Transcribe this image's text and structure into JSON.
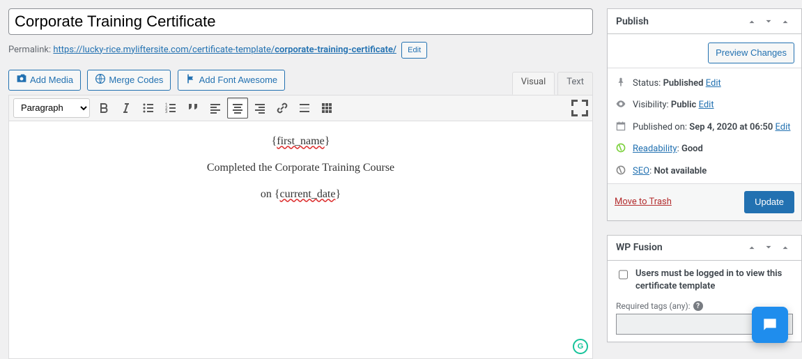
{
  "title_value": "Corporate Training Certificate",
  "permalink": {
    "label": "Permalink:",
    "base": "https://lucky-rice.myliftersite.com/certificate-template/",
    "slug": "corporate-training-certificate/",
    "edit": "Edit"
  },
  "media_buttons": {
    "add_media": "Add Media",
    "merge_codes": "Merge Codes",
    "font_awesome": "Add Font Awesome"
  },
  "editor_tabs": {
    "visual": "Visual",
    "text": "Text"
  },
  "toolbar": {
    "format_select": "Paragraph"
  },
  "content": {
    "line1_a": "{",
    "line1_b": "first_name",
    "line1_c": "}",
    "line2": "Completed the Corporate Training Course",
    "line3_a": "on {",
    "line3_b": "current_date",
    "line3_c": "}"
  },
  "publish": {
    "title": "Publish",
    "preview": "Preview Changes",
    "status_label": "Status:",
    "status_value": "Published",
    "visibility_label": "Visibility:",
    "visibility_value": "Public",
    "published_label": "Published on:",
    "published_value": "Sep 4, 2020 at 06:50",
    "readability_label": "Readability",
    "readability_value": "Good",
    "seo_label": "SEO",
    "seo_value": "Not available",
    "edit": "Edit",
    "trash": "Move to Trash",
    "update": "Update"
  },
  "wpfusion": {
    "title": "WP Fusion",
    "checkbox_label": "Users must be logged in to view this certificate template",
    "tags_label": "Required tags (any):"
  }
}
